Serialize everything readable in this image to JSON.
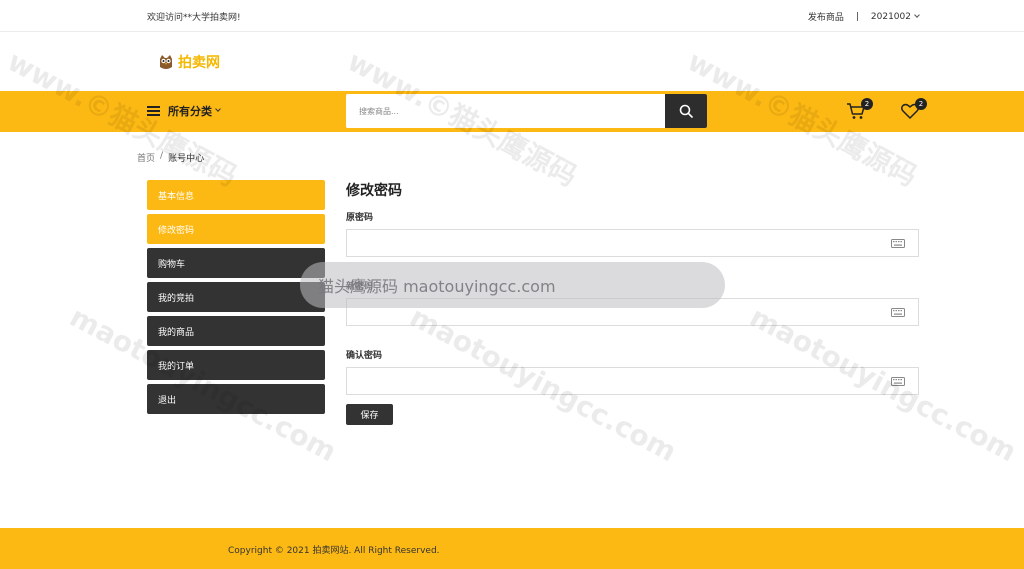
{
  "topbar": {
    "welcome": "欢迎访问**大学拍卖网!",
    "publish": "发布商品",
    "separator": "|",
    "user": "2021002"
  },
  "logo": {
    "brand": "拍卖网"
  },
  "navbar": {
    "categories_label": "所有分类",
    "search_placeholder": "搜索商品...",
    "cart_count": "2",
    "wishlist_count": "2"
  },
  "breadcrumb": {
    "home": "首页",
    "sep": "/",
    "current": "账号中心"
  },
  "sidemenu": {
    "items": [
      {
        "label": "基本信息"
      },
      {
        "label": "修改密码"
      },
      {
        "label": "购物车"
      },
      {
        "label": "我的竞拍"
      },
      {
        "label": "我的商品"
      },
      {
        "label": "我的订单"
      },
      {
        "label": "退出"
      }
    ]
  },
  "form": {
    "title": "修改密码",
    "old_password_label": "原密码",
    "new_password_label": "新密码",
    "confirm_password_label": "确认密码",
    "save_label": "保存"
  },
  "overlay": {
    "text": "猫头鹰源码 maotouyingcc.com"
  },
  "footer": {
    "copyright": "Copyright © 2021 拍卖网站. All Right Reserved."
  },
  "watermarks": {
    "items": [
      "www.©猫头鹰源码",
      "www.©猫头鹰源码",
      "www.©猫头鹰源码",
      "maotouyingcc.com",
      "maotouyingcc.com",
      "maotouyingcc.com"
    ]
  },
  "colors": {
    "accent": "#fdb913",
    "dark": "#333333"
  }
}
